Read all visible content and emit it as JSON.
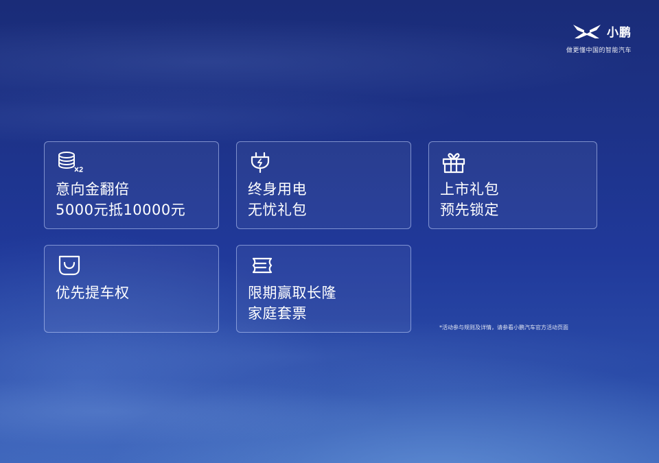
{
  "brand": {
    "logo_icon": "xpeng-x-logo-icon",
    "name": "小鹏",
    "slogan": "做更懂中国的智能汽车"
  },
  "cards": [
    {
      "icon": "coins-x2-icon",
      "line1": "意向金翻倍",
      "line2": "5000元抵10000元"
    },
    {
      "icon": "charging-plug-icon",
      "line1": "终身用电",
      "line2": "无忧礼包"
    },
    {
      "icon": "gift-box-icon",
      "line1": "上市礼包",
      "line2": "预先锁定"
    },
    {
      "icon": "shopping-bag-icon",
      "line1": "优先提车权",
      "line2": ""
    },
    {
      "icon": "ticket-icon",
      "line1": "限期赢取长隆",
      "line2": "家庭套票"
    }
  ],
  "footnote": "*活动参与规则及详情，请参看小鹏汽车官方活动页面",
  "colors": {
    "background_top": "#1a2c78",
    "background_bottom": "#3a62b8",
    "text": "#ffffff"
  }
}
